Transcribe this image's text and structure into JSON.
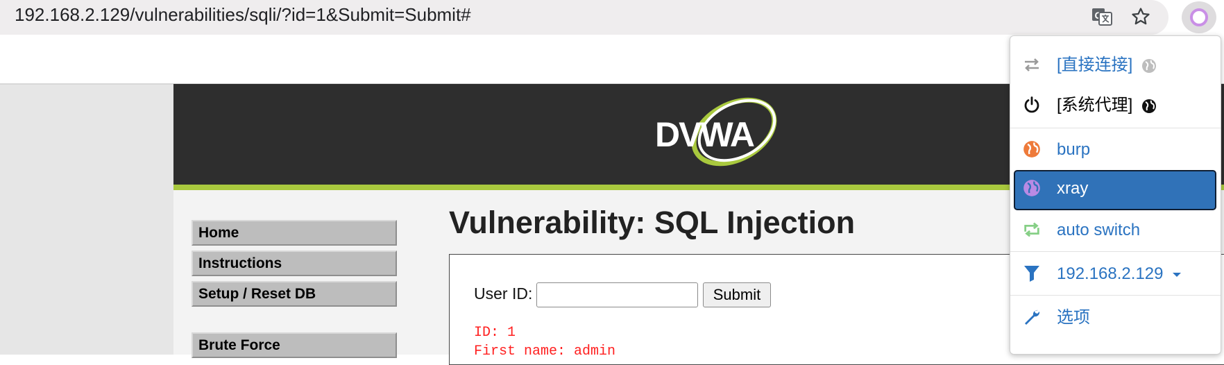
{
  "browser": {
    "url": "192.168.2.129/vulnerabilities/sqli/?id=1&Submit=Submit#",
    "icons": [
      "translate-icon",
      "bookmark-star-icon",
      "proxy-extension-icon"
    ]
  },
  "dvwa": {
    "logo_text": "DVWA",
    "page_title": "Vulnerability: SQL Injection",
    "menu": [
      "Home",
      "Instructions",
      "Setup / Reset DB",
      "Brute Force"
    ],
    "form": {
      "label": "User ID:",
      "input_value": "",
      "submit_label": "Submit"
    },
    "result": [
      "ID: 1",
      "First name: admin"
    ]
  },
  "proxy_popup": {
    "items": [
      {
        "label": "[直接连接]",
        "icon": "transfer-arrows-icon",
        "color": "#2a73c1"
      },
      {
        "label": "[系统代理]",
        "icon": "power-icon",
        "color": "#000000"
      },
      {
        "label": "burp",
        "icon": "globe-icon",
        "color": "#2a73c1"
      },
      {
        "label": "xray",
        "icon": "globe-icon",
        "color": "#ffffff",
        "selected": true
      },
      {
        "label": "auto switch",
        "icon": "auto-switch-icon",
        "color": "#2a73c1"
      },
      {
        "label": "192.168.2.129",
        "icon": "filter-icon",
        "color": "#2a73c1"
      },
      {
        "label": "选项",
        "icon": "wrench-icon",
        "color": "#2a73c1"
      }
    ]
  },
  "colors": {
    "header_bg": "#2e2e2e",
    "header_accent": "#a9c93e",
    "selected_bg": "#3072b8",
    "link": "#2a73c1",
    "result_text": "#ff2020"
  }
}
